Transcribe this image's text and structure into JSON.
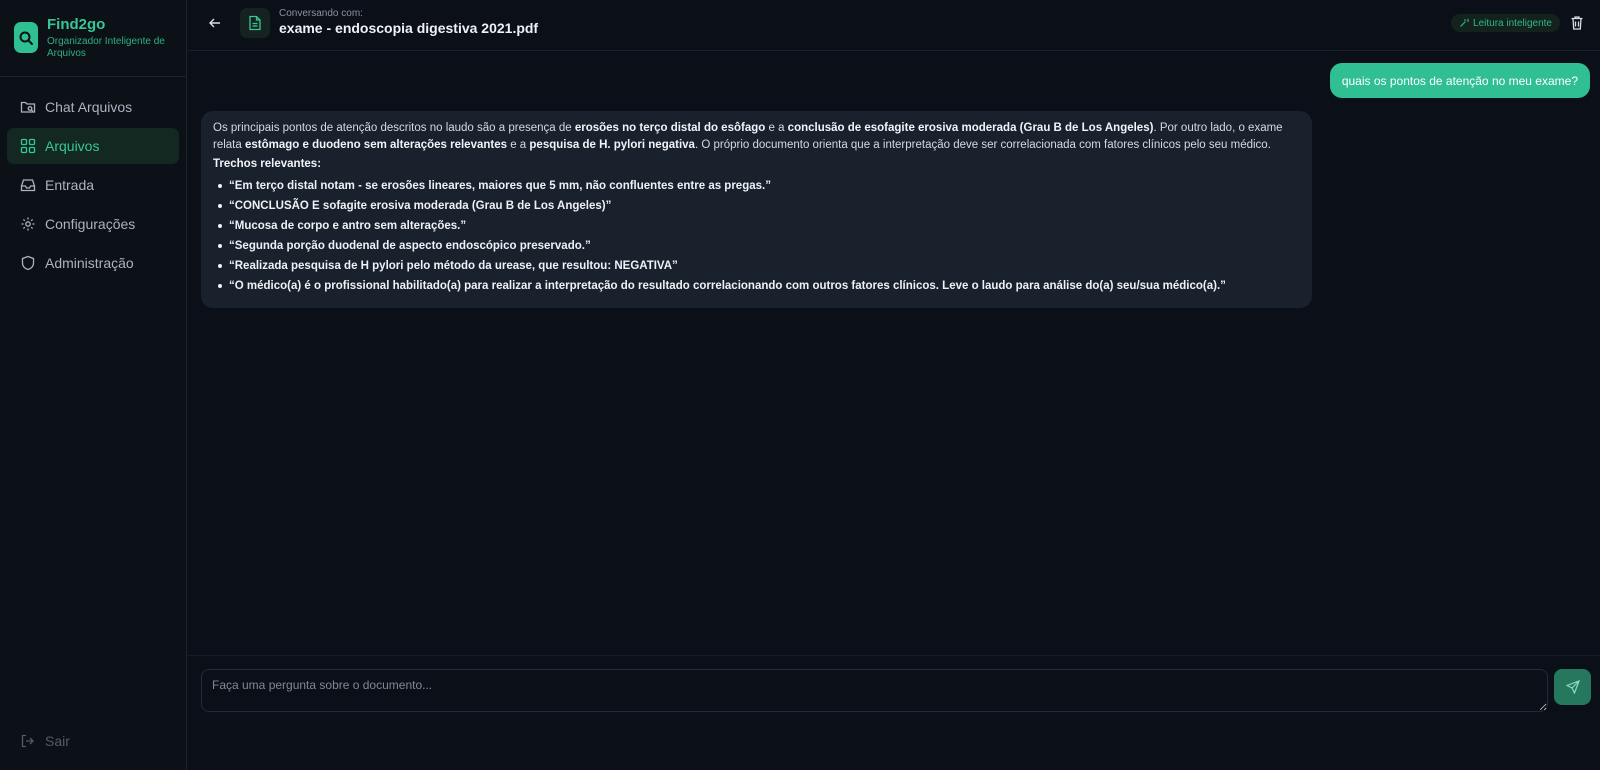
{
  "brand": {
    "name": "Find2go",
    "subtitle": "Organizador Inteligente de Arquivos"
  },
  "sidebar": {
    "items": [
      {
        "label": "Chat Arquivos",
        "icon": "folder-search-icon",
        "active": false
      },
      {
        "label": "Arquivos",
        "icon": "grid-icon",
        "active": true
      },
      {
        "label": "Entrada",
        "icon": "inbox-icon",
        "active": false
      },
      {
        "label": "Configurações",
        "icon": "gear-icon",
        "active": false
      },
      {
        "label": "Administração",
        "icon": "shield-icon",
        "active": false
      }
    ],
    "logout_label": "Sair"
  },
  "header": {
    "conversing_label": "Conversando com:",
    "document_title": "exame - endoscopia digestiva 2021.pdf",
    "badge": "Leitura inteligente"
  },
  "chat": {
    "user_message": "quais os pontos de atenção no meu exame?",
    "assistant": {
      "p1": "Os principais pontos de atenção descritos no laudo são a presença de ",
      "b1": "erosões no terço distal do esôfago",
      "p2": " e a ",
      "b2": "conclusão de esofagite erosiva moderada (Grau B de Los Angeles)",
      "p3": ". Por outro lado, o exame relata ",
      "b3": "estômago e duodeno sem alterações relevantes",
      "p4": " e a ",
      "b4": "pesquisa de H. pylori negativa",
      "p5": ". O próprio documento orienta que a interpretação deve ser correlacionada com fatores clínicos pelo seu médico.",
      "excerpts_heading": "Trechos relevantes:",
      "excerpts": [
        "“Em terço distal notam - se erosões lineares, maiores que 5 mm, não confluentes entre as pregas.”",
        "“CONCLUSÃO E sofagite erosiva moderada (Grau B de Los Angeles)”",
        "“Mucosa de corpo e antro sem alterações.”",
        "“Segunda porção duodenal de aspecto endoscópico preservado.”",
        "“Realizada pesquisa de H pylori pelo método da urease, que resultou: NEGATIVA”",
        "“O médico(a) é o profissional habilitado(a) para realizar a interpretação do resultado correlacionando com outros fatores clínicos. Leve o laudo para análise do(a) seu/sua médico(a).”"
      ]
    }
  },
  "composer": {
    "placeholder": "Faça uma pergunta sobre o documento..."
  },
  "colors": {
    "accent": "#2fbf93",
    "background": "#0b1018",
    "bubble": "#19212d"
  }
}
